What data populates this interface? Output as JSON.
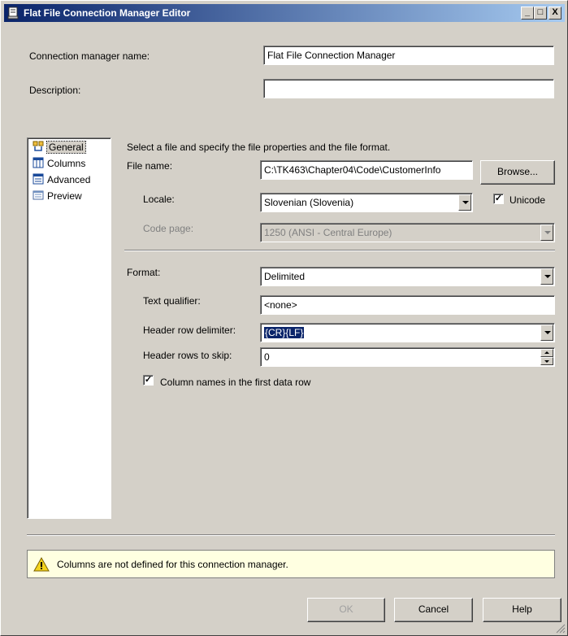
{
  "window": {
    "title": "Flat File Connection Manager Editor",
    "controls": {
      "minimize": "_",
      "maximize": "□",
      "close": "X"
    }
  },
  "header": {
    "name_label": "Connection manager name:",
    "name_value": "Flat File Connection Manager",
    "description_label": "Description:",
    "description_value": ""
  },
  "nav": {
    "items": [
      {
        "label": "General",
        "icon": "general-icon",
        "selected": true
      },
      {
        "label": "Columns",
        "icon": "columns-icon"
      },
      {
        "label": "Advanced",
        "icon": "advanced-icon"
      },
      {
        "label": "Preview",
        "icon": "preview-icon"
      }
    ]
  },
  "general": {
    "intro": "Select a file and specify the file properties and the file format.",
    "file_name_label": "File name:",
    "file_name_value": "C:\\TK463\\Chapter04\\Code\\CustomerInfo",
    "browse_label": "Browse...",
    "locale_label": "Locale:",
    "locale_value": "Slovenian (Slovenia)",
    "unicode_label": "Unicode",
    "unicode_checked": true,
    "codepage_label": "Code page:",
    "codepage_value": "1250  (ANSI - Central Europe)",
    "format_label": "Format:",
    "format_value": "Delimited",
    "text_qualifier_label": "Text qualifier:",
    "text_qualifier_value": "<none>",
    "header_delim_label": "Header row delimiter:",
    "header_delim_value": "{CR}{LF}",
    "header_skip_label": "Header rows to skip:",
    "header_skip_value": "0",
    "colnames_label": "Column names in the first data row",
    "colnames_checked": true
  },
  "info": {
    "icon": "warning-icon",
    "message": "Columns are not defined for this connection manager."
  },
  "buttons": {
    "ok": "OK",
    "cancel": "Cancel",
    "help": "Help"
  },
  "colors": {
    "title_start": "#0a246a",
    "title_end": "#a6caf0",
    "face": "#d4d0c8",
    "info_bg": "#ffffe1"
  }
}
